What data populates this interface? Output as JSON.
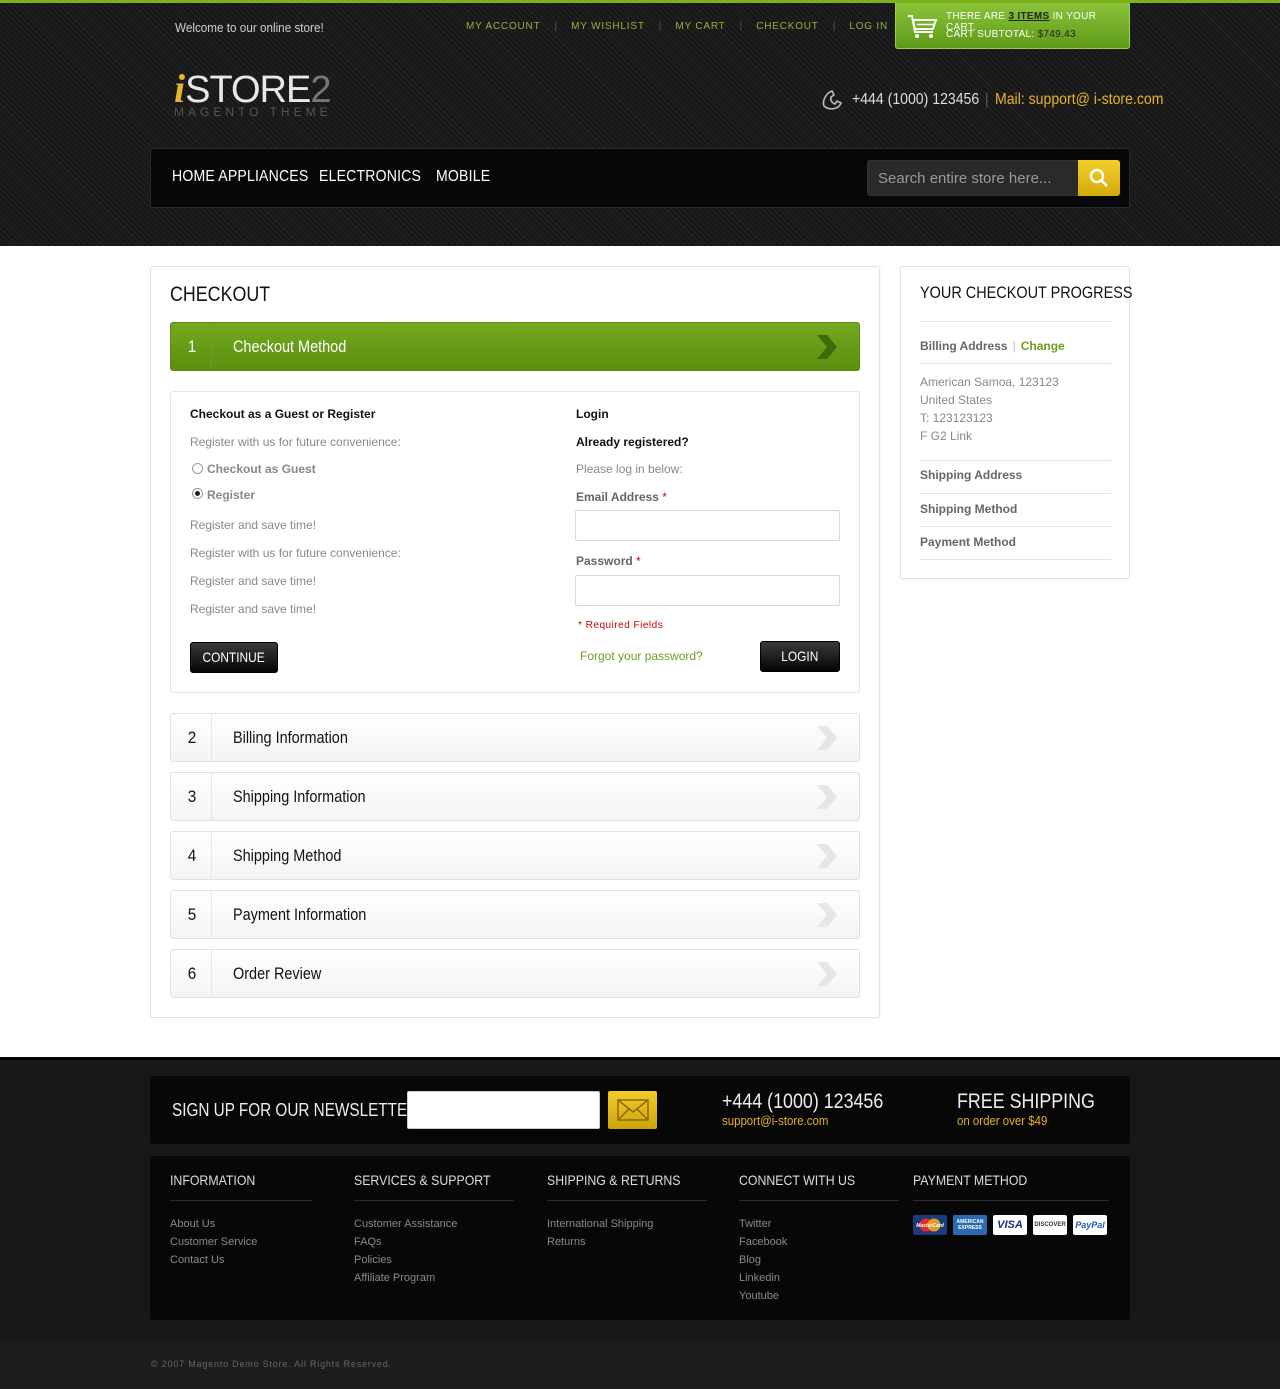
{
  "header": {
    "welcome": "Welcome to our online store!",
    "toplinks": [
      "MY ACCOUNT",
      "MY WISHLIST",
      "MY CART",
      "CHECKOUT",
      "LOG IN"
    ],
    "cart": {
      "prefix": "THERE ARE",
      "items": "3 ITEMS",
      "suffix": "IN YOUR CART.",
      "subtotal_label": "CART SUBTOTAL:",
      "subtotal": "$749.43"
    },
    "logo": {
      "i": "i",
      "store": "STORE",
      "two": "2",
      "sub": "MAGENTO THEME"
    },
    "phone": "+444 (1000) 123456",
    "mail": "Mail: support@ i-store.com",
    "nav": [
      "HOME APPLIANCES",
      "ELECTRONICS",
      "MOBILE"
    ],
    "search_placeholder": "Search entire store here..."
  },
  "checkout": {
    "title": "CHECKOUT",
    "steps": [
      {
        "num": "1",
        "title": "Checkout Method"
      },
      {
        "num": "2",
        "title": "Billing Information"
      },
      {
        "num": "3",
        "title": "Shipping Information"
      },
      {
        "num": "4",
        "title": "Shipping Method"
      },
      {
        "num": "5",
        "title": "Payment Information"
      },
      {
        "num": "6",
        "title": "Order Review"
      }
    ],
    "guest": {
      "heading": "Checkout as a Guest or Register",
      "intro": "Register with us for future convenience:",
      "opt_guest": "Checkout as Guest",
      "opt_register": "Register",
      "lines": [
        "Register and save time!",
        "Register with us for future convenience:",
        "Register and save time!",
        "Register and save time!"
      ],
      "continue": "CONTINUE"
    },
    "login": {
      "heading": "Login",
      "sub": "Already registered?",
      "intro": "Please log in below:",
      "email_label": "Email Address",
      "password_label": "Password",
      "required_mark": "*",
      "required_note": "* Required Fields",
      "forgot": "Forgot your password?",
      "button": "LOGIN"
    }
  },
  "progress": {
    "title": "YOUR CHECKOUT PROGRESS",
    "billing": "Billing Address",
    "sep": "|",
    "change": "Change",
    "address": [
      "American Samoa, 123123",
      "United States",
      "T: 123123123",
      "F G2 Link"
    ],
    "shipping_address": "Shipping Address",
    "shipping_method": "Shipping Method",
    "payment_method": "Payment Method"
  },
  "footer": {
    "newsletter": "SIGN UP FOR OUR NEWSLETTER",
    "phone": "+444 (1000) 123456",
    "email": "support@i-store.com",
    "free_shipping": "FREE SHIPPING",
    "free_shipping_sub": "on order over $49",
    "columns": [
      {
        "title": "INFORMATION",
        "links": [
          "About Us",
          "Customer Service",
          "Contact Us"
        ]
      },
      {
        "title": "SERVICES & SUPPORT",
        "links": [
          "Customer Assistance",
          "FAQs",
          "Policies",
          "Affiliate Program"
        ]
      },
      {
        "title": "SHIPPING & RETURNS",
        "links": [
          "International Shipping",
          "Returns"
        ]
      },
      {
        "title": "CONNECT WITH US",
        "links": [
          "Twitter",
          "Facebook",
          "Blog",
          "Linkedin",
          "Youtube"
        ]
      }
    ],
    "payment_title": "PAYMENT METHOD",
    "cards": [
      "MasterCard",
      "AMERICAN EXPRESS",
      "VISA",
      "DISCOVER",
      "PayPal"
    ],
    "copyright": "© 2007 Magento Demo Store. All Rights Reserved."
  },
  "colors": {
    "accent_green": "#6a9f1e",
    "accent_yellow": "#e6b31c",
    "header_bg": "#1b1b1b"
  }
}
